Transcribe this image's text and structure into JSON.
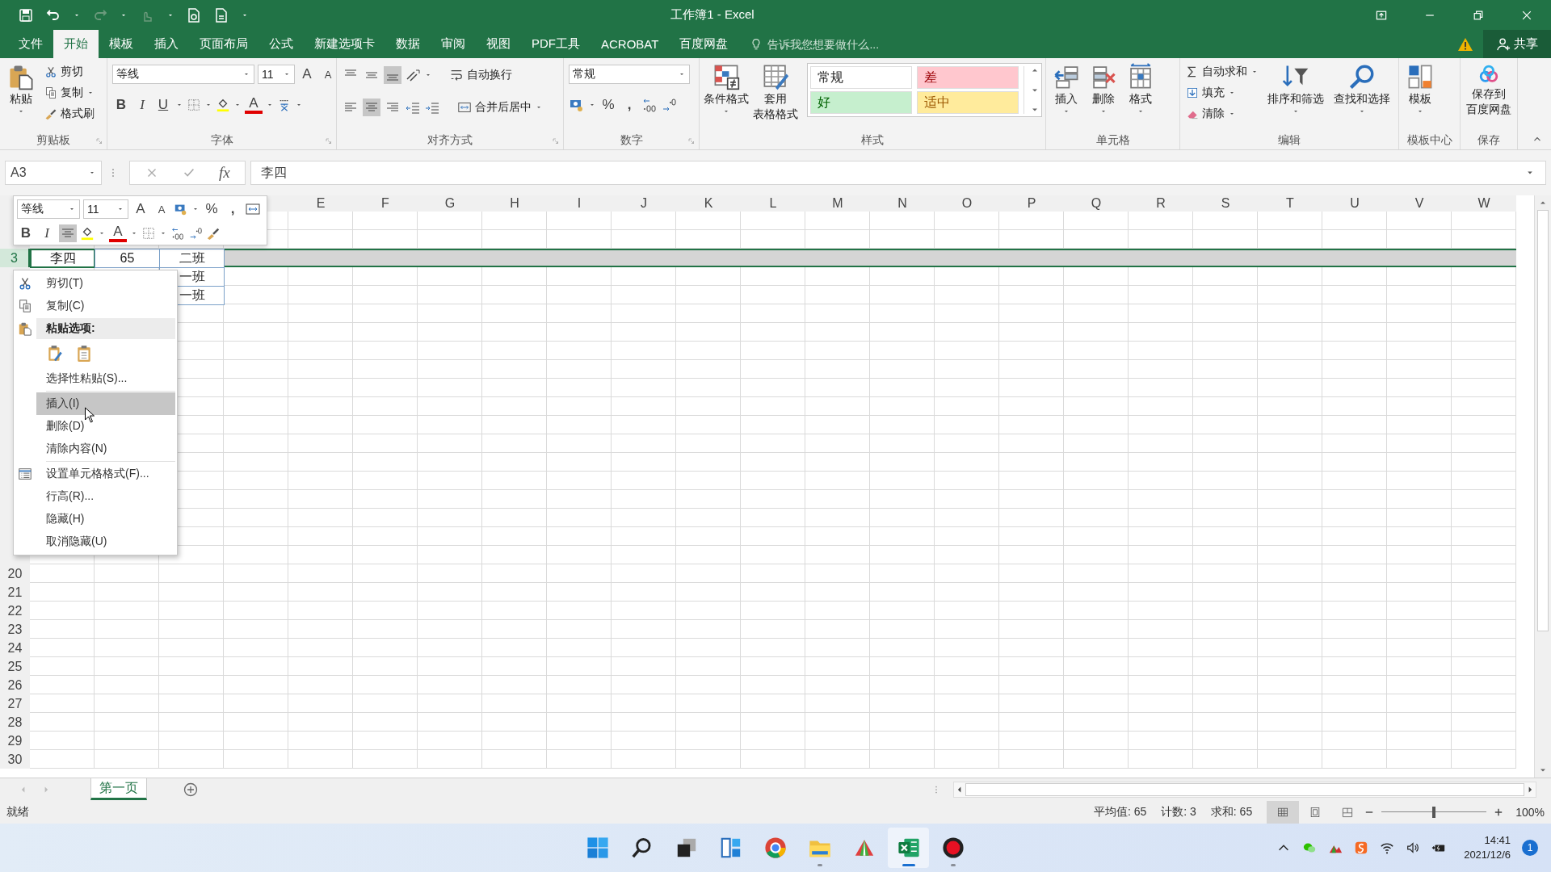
{
  "window": {
    "title": "工作簿1 - Excel"
  },
  "tabs": [
    {
      "label": "文件",
      "selected": false
    },
    {
      "label": "开始",
      "selected": true
    },
    {
      "label": "模板",
      "selected": false
    },
    {
      "label": "插入",
      "selected": false
    },
    {
      "label": "页面布局",
      "selected": false
    },
    {
      "label": "公式",
      "selected": false
    },
    {
      "label": "新建选项卡",
      "selected": false
    },
    {
      "label": "数据",
      "selected": false
    },
    {
      "label": "审阅",
      "selected": false
    },
    {
      "label": "视图",
      "selected": false
    },
    {
      "label": "PDF工具",
      "selected": false
    },
    {
      "label": "ACROBAT",
      "selected": false
    },
    {
      "label": "百度网盘",
      "selected": false
    }
  ],
  "tell_me": {
    "placeholder": "告诉我您想要做什么..."
  },
  "share": "共享",
  "ribbon": {
    "clipboard": {
      "title": "剪贴板",
      "paste": "粘贴",
      "cut": "剪切",
      "copy": "复制",
      "format_painter": "格式刷"
    },
    "font": {
      "title": "字体",
      "font_name": "等线",
      "font_size": "11",
      "grow": "A",
      "shrink": "A",
      "bold": "B",
      "italic": "I",
      "underline": "U",
      "font_color": "A"
    },
    "alignment": {
      "title": "对齐方式",
      "wrap_text": "自动换行",
      "merge_center": "合并后居中",
      "vertical": [
        {
          "selected": false
        },
        {
          "selected": false
        },
        {
          "selected": true
        }
      ],
      "horizontal": [
        {
          "selected": false
        },
        {
          "selected": true
        },
        {
          "selected": false
        }
      ]
    },
    "number": {
      "title": "数字",
      "format": "常规",
      "percent": "%",
      "comma": ","
    },
    "styles": {
      "title": "样式",
      "conditional": "条件格式",
      "table_format": [
        "套用",
        "表格格式"
      ],
      "gallery": [
        {
          "label": "常规",
          "color": "#ffffff"
        },
        {
          "label": "差",
          "color": "#ffc7ce"
        },
        {
          "label": "好",
          "color": "#c6efce"
        },
        {
          "label": "适中",
          "color": "#ffeb9c"
        }
      ]
    },
    "cells": {
      "title": "单元格",
      "buttons": [
        "插入",
        "删除",
        "格式"
      ]
    },
    "editing": {
      "title": "编辑",
      "autosum": "自动求和",
      "fill": "填充",
      "clear": "清除",
      "sort_filter": "排序和筛选",
      "find_select": "查找和选择"
    },
    "template_center": {
      "title": "模板中心",
      "button": "模板"
    },
    "save": {
      "title": "保存",
      "button": [
        "保存到",
        "百度网盘"
      ]
    }
  },
  "formula_bar": {
    "name_box": "A3",
    "fx": "fx",
    "content": "李四"
  },
  "mini_toolbar": {
    "font_name": "等线",
    "font_size": "11",
    "grow": "A",
    "shrink": "A",
    "percent": "%",
    "comma": ",",
    "bold": "B",
    "italic": "I",
    "font_color": "A",
    "center_selected": true
  },
  "sheet": {
    "columns": [
      "E",
      "F",
      "G",
      "H",
      "I",
      "J",
      "K",
      "L",
      "M",
      "N",
      "O",
      "P",
      "Q",
      "R",
      "S",
      "T",
      "U",
      "V",
      "W"
    ],
    "rows": [
      {},
      {},
      {
        "header": "3",
        "selected": true,
        "cells": {
          "A": "李四",
          "B": "65",
          "C": "二班"
        }
      },
      {
        "cells": {
          "C": "一班"
        }
      },
      {
        "cells": {
          "C": "一班"
        }
      },
      {},
      {},
      {},
      {},
      {},
      {},
      {},
      {},
      {},
      {},
      {},
      {},
      {},
      {},
      {
        "header": "20",
        "selected": false
      },
      {
        "header": "21",
        "selected": false
      },
      {
        "header": "22",
        "selected": false
      },
      {
        "header": "23",
        "selected": false
      },
      {
        "header": "24",
        "selected": false
      },
      {
        "header": "25",
        "selected": false
      },
      {
        "header": "26",
        "selected": false
      },
      {
        "header": "27",
        "selected": false
      },
      {
        "header": "28",
        "selected": false
      },
      {
        "header": "29",
        "selected": false
      },
      {
        "header": "30",
        "selected": false
      }
    ]
  },
  "context_menu": [
    {
      "kind": "item",
      "label": "剪切(T)",
      "selected": false
    },
    {
      "kind": "item",
      "label": "复制(C)",
      "selected": false
    },
    {
      "kind": "header",
      "label": "粘贴选项:"
    },
    {
      "kind": "paste_icons"
    },
    {
      "kind": "item",
      "label": "选择性粘贴(S)...",
      "selected": false
    },
    {
      "kind": "separator"
    },
    {
      "kind": "item",
      "label": "插入(I)",
      "selected": true
    },
    {
      "kind": "item",
      "label": "删除(D)",
      "selected": false
    },
    {
      "kind": "item",
      "label": "清除内容(N)",
      "selected": false
    },
    {
      "kind": "separator"
    },
    {
      "kind": "item",
      "label": "设置单元格格式(F)...",
      "selected": false
    },
    {
      "kind": "item",
      "label": "行高(R)...",
      "selected": false
    },
    {
      "kind": "item",
      "label": "隐藏(H)",
      "selected": false
    },
    {
      "kind": "item",
      "label": "取消隐藏(U)",
      "selected": false
    }
  ],
  "sheet_tabs": [
    {
      "label": "第一页",
      "selected": true
    }
  ],
  "status_bar": {
    "status": "就绪",
    "average": "平均值: 65",
    "count": "计数: 3",
    "sum": "求和: 65",
    "views": [
      {
        "selected": true
      },
      {
        "selected": false
      },
      {
        "selected": false
      }
    ],
    "zoom": {
      "level": 0.5,
      "reading": "100%"
    }
  },
  "taskbar": {
    "apps": [
      {
        "running": false,
        "active": false
      },
      {
        "running": false,
        "active": false
      },
      {
        "running": false,
        "active": false
      },
      {
        "running": false,
        "active": false
      },
      {
        "running": false,
        "active": false
      },
      {
        "running": true,
        "active": false
      },
      {
        "running": false,
        "active": false
      },
      {
        "running": true,
        "active": true
      },
      {
        "running": true,
        "active": false
      }
    ],
    "time": "14:41",
    "date": "2021/12/6",
    "notifications": "1"
  }
}
